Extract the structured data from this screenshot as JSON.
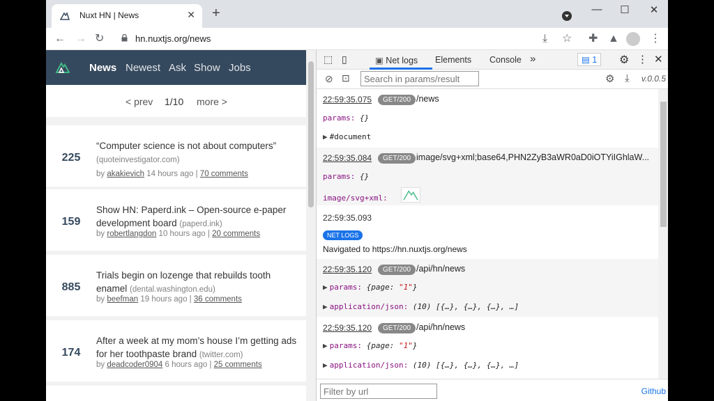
{
  "browser": {
    "tab_title": "Nuxt HN | News",
    "tab_close": "✕",
    "new_tab": "+",
    "url": "hn.nuxtjs.org/news",
    "window_controls": {
      "minimize": "—",
      "maximize": "☐",
      "close": "✕"
    }
  },
  "hn": {
    "nav": [
      "News",
      "Newest",
      "Ask",
      "Show",
      "Jobs"
    ],
    "pager": {
      "prev": "< prev",
      "page": "1/10",
      "more": "more >"
    },
    "items": [
      {
        "score": "225",
        "title": "“Computer science is not about computers”",
        "host": "(quoteinvestigator.com)",
        "by": "by",
        "user": "akakievich",
        "time": "14 hours ago |",
        "comments": "70 comments"
      },
      {
        "score": "159",
        "title": "Show HN: Paperd.ink – Open-source e-paper development board",
        "host": "(paperd.ink)",
        "by": "by",
        "user": "robertlangdon",
        "time": "10 hours ago |",
        "comments": "20 comments"
      },
      {
        "score": "885",
        "title": "Trials begin on lozenge that rebuilds tooth enamel",
        "host": "(dental.washington.edu)",
        "by": "by",
        "user": "beefman",
        "time": "19 hours ago |",
        "comments": "36 comments"
      },
      {
        "score": "174",
        "title": "After a week at my mom’s house I’m getting ads for her toothpaste brand",
        "host": "(twitter.com)",
        "by": "by",
        "user": "deadcoder0904",
        "time": "6 hours ago |",
        "comments": "25 comments"
      }
    ]
  },
  "devtools": {
    "tabs": {
      "netlogs": "Net logs",
      "elements": "Elements",
      "console": "Console",
      "more": "»"
    },
    "issues_count": "1",
    "search_placeholder": "Search in params/result",
    "version": "v.0.0.5",
    "filter_placeholder": "Filter by url",
    "github": "Github",
    "entries": [
      {
        "ts": "22:59:35.075",
        "badge": "GET/200",
        "path": "/news",
        "params_key": "params:",
        "params_val": "{}",
        "doc": "#document"
      },
      {
        "ts": "22:59:35.084",
        "badge": "GET/200",
        "path": "image/svg+xml;base64,PHN2ZyB3aWR0aD0iOTYiIGhlaW...",
        "params_key": "params:",
        "params_val": "{}",
        "mime": "image/svg+xml:"
      },
      {
        "ts": "22:59:35.093",
        "badge": "NET LOGS",
        "text": "Navigated to https://hn.nuxtjs.org/news"
      },
      {
        "ts": "22:59:35.120",
        "badge": "GET/200",
        "path": "/api/hn/news",
        "params_key": "params:",
        "params_open": "{page:",
        "params_str": "\"1\"",
        "params_close": "}",
        "json_key": "application/json:",
        "json_val": "(10) [{…}, {…}, {…}, …]"
      },
      {
        "ts": "22:59:35.120",
        "badge": "GET/200",
        "path": "/api/hn/news",
        "params_key": "params:",
        "params_open": "{page:",
        "params_str": "\"1\"",
        "params_close": "}",
        "json_key": "application/json:",
        "json_val": "(10) [{…}, {…}, {…}, …]"
      }
    ]
  }
}
